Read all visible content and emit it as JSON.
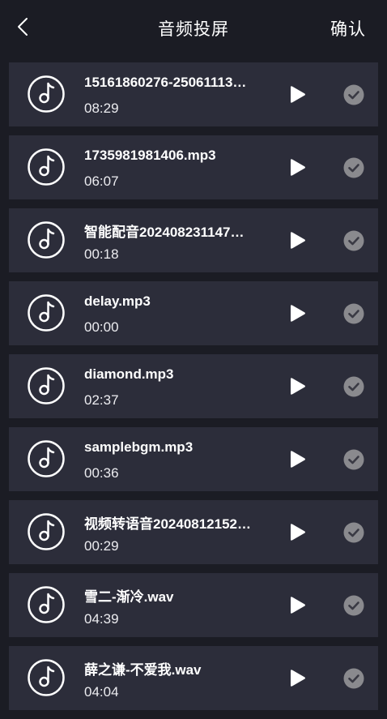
{
  "header": {
    "title": "音频投屏",
    "confirm_label": "确认",
    "back_icon": "chevron-left-icon"
  },
  "colors": {
    "background": "#1b1c24",
    "card": "#2c2d3a",
    "check_circle": "#8a8a8e",
    "text": "#ffffff"
  },
  "items": [
    {
      "name": "15161860276-25061113…",
      "duration": "08:29"
    },
    {
      "name": "1735981981406.mp3",
      "duration": "06:07"
    },
    {
      "name": "智能配音202408231147…",
      "duration": "00:18"
    },
    {
      "name": "delay.mp3",
      "duration": "00:00"
    },
    {
      "name": "diamond.mp3",
      "duration": "02:37"
    },
    {
      "name": "samplebgm.mp3",
      "duration": "00:36"
    },
    {
      "name": "视频转语音20240812152…",
      "duration": "00:29"
    },
    {
      "name": "雪二-渐冷.wav",
      "duration": "04:39"
    },
    {
      "name": "薛之谦-不爱我.wav",
      "duration": "04:04"
    }
  ]
}
